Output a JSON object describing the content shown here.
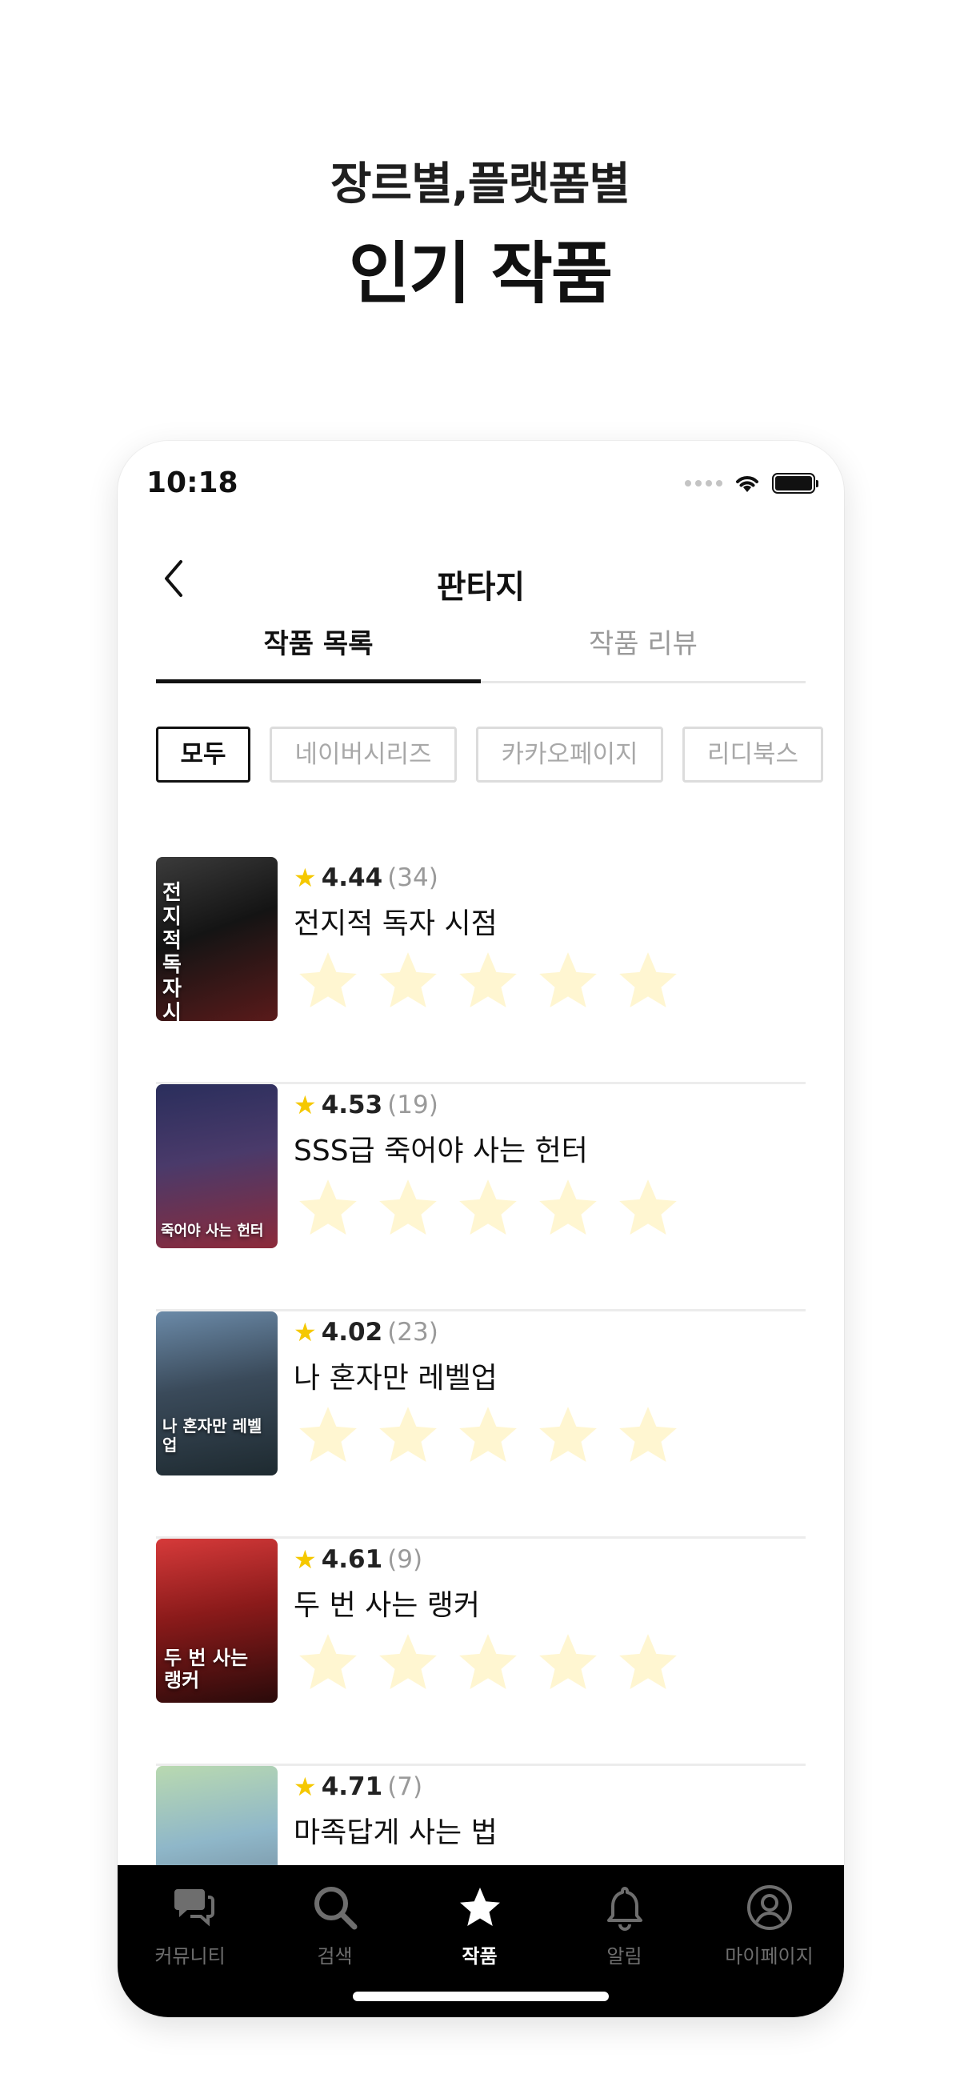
{
  "headline": {
    "line1": "장르별,플랫폼별",
    "line2": "인기 작품"
  },
  "status": {
    "time": "10:18"
  },
  "nav": {
    "title": "판타지"
  },
  "tabs": [
    {
      "label": "작품 목록",
      "active": true
    },
    {
      "label": "작품 리뷰",
      "active": false
    }
  ],
  "chips": [
    {
      "label": "모두",
      "active": true
    },
    {
      "label": "네이버시리즈",
      "active": false
    },
    {
      "label": "카카오페이지",
      "active": false
    },
    {
      "label": "리디북스",
      "active": false
    }
  ],
  "works": [
    {
      "rating": "4.44",
      "count": "(34)",
      "title": "전지적 독자 시점",
      "cover_text": "전지적 독자시점",
      "user_rating": 0
    },
    {
      "rating": "4.53",
      "count": "(19)",
      "title": "SSS급 죽어야 사는 헌터",
      "cover_text": "죽어야 사는 헌터",
      "user_rating": 0
    },
    {
      "rating": "4.02",
      "count": "(23)",
      "title": "나 혼자만 레벨업",
      "cover_text": "나 혼자만 레벨업",
      "user_rating": 0
    },
    {
      "rating": "4.61",
      "count": "(9)",
      "title": "두 번 사는 랭커",
      "cover_text": "두 번 사는 랭커",
      "user_rating": 0
    },
    {
      "rating": "4.71",
      "count": "(7)",
      "title": "마족답게 사는 법",
      "cover_text": "",
      "user_rating": 0
    }
  ],
  "tabbar": [
    {
      "label": "커뮤니티",
      "icon": "chat-bubbles-icon",
      "active": false
    },
    {
      "label": "검색",
      "icon": "search-icon",
      "active": false
    },
    {
      "label": "작품",
      "icon": "star-icon",
      "active": true
    },
    {
      "label": "알림",
      "icon": "bell-icon",
      "active": false
    },
    {
      "label": "마이페이지",
      "icon": "profile-icon",
      "active": false
    }
  ],
  "colors": {
    "accent_star": "#f5c800",
    "empty_star": "#fff6d1",
    "tabbar_bg": "#000000"
  }
}
